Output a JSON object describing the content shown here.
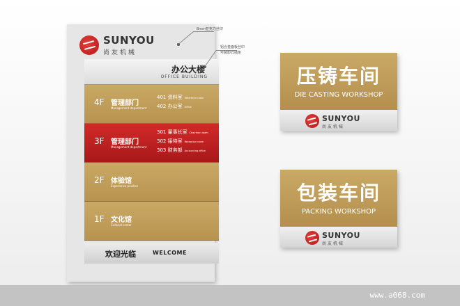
{
  "brand": {
    "name_en": "SUNYOU",
    "name_cn": "尚友机械",
    "logo_color": "#c21f1f"
  },
  "colors": {
    "gold": "#c2a25e",
    "red": "#c92422",
    "silver": "#e0e0e0"
  },
  "callouts": {
    "top": "8mm亚克力丝印",
    "mid_line1": "铝合金面板丝印",
    "mid_line2": "可装卸式插条"
  },
  "board": {
    "office": {
      "cn": "办公大楼",
      "en": "OFFICE BUILDING"
    },
    "floors": [
      {
        "floor": "4F",
        "name": "管理部门",
        "sub": "Management department",
        "rooms": [
          {
            "no": "401",
            "name": "资料室",
            "en": "Reference room"
          },
          {
            "no": "402",
            "name": "办公室",
            "en": "Office"
          }
        ]
      },
      {
        "floor": "3F",
        "name": "管理部门",
        "sub": "Management department",
        "rooms": [
          {
            "no": "301",
            "name": "董事长室",
            "en": "Chairman room"
          },
          {
            "no": "302",
            "name": "接待室",
            "en": "Reception room"
          },
          {
            "no": "303",
            "name": "财务部",
            "en": "Accounting office"
          }
        ]
      },
      {
        "floor": "2F",
        "name": "体验馆",
        "sub": "Experience pavilion",
        "rooms": []
      },
      {
        "floor": "1F",
        "name": "文化馆",
        "sub": "Cultural center",
        "rooms": []
      }
    ],
    "welcome": {
      "cn": "欢迎光临",
      "en": "WELCOME"
    }
  },
  "signs": [
    {
      "cn": "压铸车间",
      "en": "DIE CASTING WORKSHOP"
    },
    {
      "cn": "包装车间",
      "en": "PACKING WORKSHOP"
    }
  ],
  "footer": {
    "watermark": "www.a068.com"
  }
}
